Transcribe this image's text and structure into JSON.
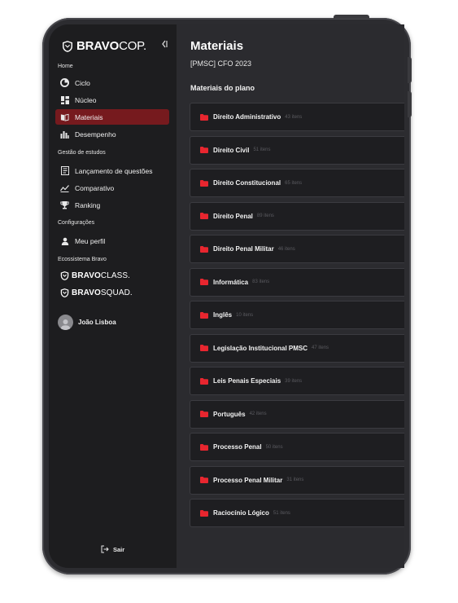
{
  "brand": {
    "logo_bold": "BRAVO",
    "logo_thin": "COP."
  },
  "sidebar": {
    "sections": [
      {
        "label": "Home"
      },
      {
        "label": "Gestão de estudos"
      },
      {
        "label": "Configurações"
      },
      {
        "label": "Ecossistema Bravo"
      }
    ],
    "items": [
      {
        "label": "Ciclo",
        "icon": "pie-chart-icon",
        "active": false
      },
      {
        "label": "Núcleo",
        "icon": "grid-icon",
        "active": false
      },
      {
        "label": "Materiais",
        "icon": "book-icon",
        "active": true
      },
      {
        "label": "Desempenho",
        "icon": "bar-chart-icon",
        "active": false
      },
      {
        "label": "Lançamento de questões",
        "icon": "list-icon",
        "active": false
      },
      {
        "label": "Comparativo",
        "icon": "line-chart-icon",
        "active": false
      },
      {
        "label": "Ranking",
        "icon": "trophy-icon",
        "active": false
      },
      {
        "label": "Meu perfil",
        "icon": "user-icon",
        "active": false
      }
    ],
    "ecosystem": [
      {
        "bold": "BRAVO",
        "thin": "CLASS."
      },
      {
        "bold": "BRAVO",
        "thin": "SQUAD."
      }
    ],
    "user_name": "João Lisboa",
    "logout_label": "Sair"
  },
  "main": {
    "title": "Materiais",
    "plan_name": "[PMSC] CFO 2023",
    "section_title": "Materiais do plano",
    "materials": [
      {
        "name": "Direito Administrativo",
        "count": "43 itens"
      },
      {
        "name": "Direito Civil",
        "count": "51 itens"
      },
      {
        "name": "Direito Constitucional",
        "count": "65 itens"
      },
      {
        "name": "Direito Penal",
        "count": "89 itens"
      },
      {
        "name": "Direito Penal Militar",
        "count": "46 itens"
      },
      {
        "name": "Informática",
        "count": "83 itens"
      },
      {
        "name": "Inglês",
        "count": "10 itens"
      },
      {
        "name": "Legislação Institucional PMSC",
        "count": "47 itens"
      },
      {
        "name": "Leis Penais Especiais",
        "count": "39 itens"
      },
      {
        "name": "Português",
        "count": "42 itens"
      },
      {
        "name": "Processo Penal",
        "count": "50 itens"
      },
      {
        "name": "Processo Penal Militar",
        "count": "31 itens"
      },
      {
        "name": "Raciocínio Lógico",
        "count": "51 itens"
      }
    ]
  },
  "colors": {
    "accent": "#e8262f",
    "active_bg": "#761a1e",
    "sidebar_bg": "#1d1d1f",
    "main_bg": "#2b2b2f",
    "row_bg": "#1e1e21"
  }
}
